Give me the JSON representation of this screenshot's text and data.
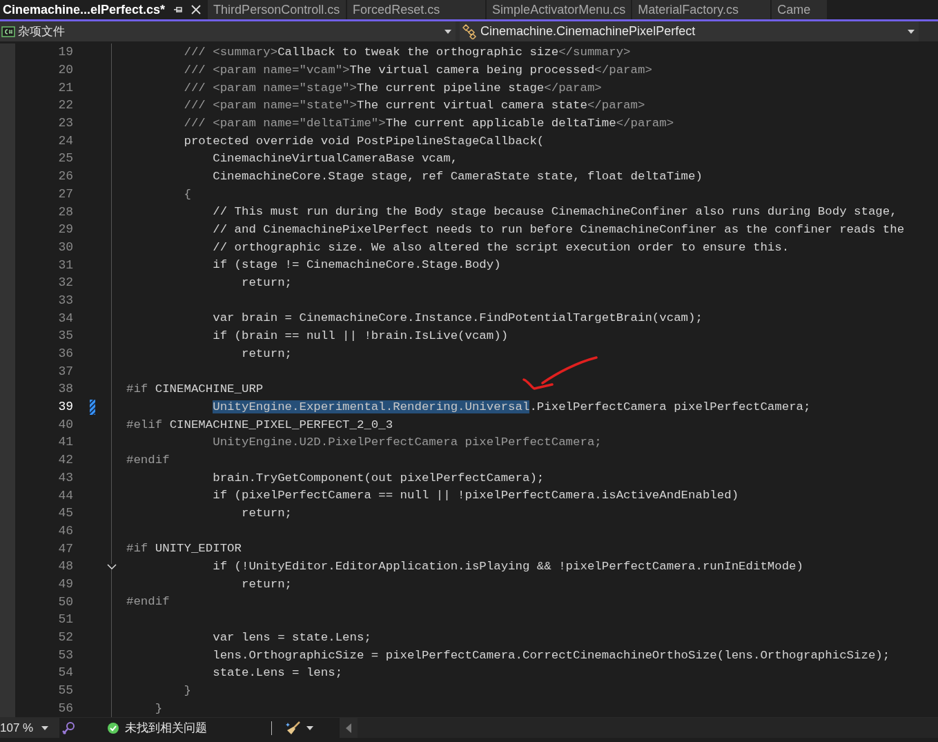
{
  "tabs": [
    {
      "label": "Cinemachine...elPerfect.cs*",
      "selected": true
    },
    {
      "label": "ThirdPersonControll.cs",
      "selected": false
    },
    {
      "label": "ForcedReset.cs",
      "selected": false
    },
    {
      "label": "SimpleActivatorMenu.cs",
      "selected": false
    },
    {
      "label": "MaterialFactory.cs",
      "selected": false
    },
    {
      "label": "Came",
      "selected": false
    }
  ],
  "nav_bar": {
    "project": "杂项文件",
    "class": "Cinemachine.CinemachinePixelPerfect"
  },
  "editor": {
    "lines": [
      {
        "number": "19",
        "current": false,
        "changed": false,
        "fold": false,
        "segments": [
          {
            "text": "        /// <summary>",
            "kind": "muted"
          },
          {
            "text": "Callback to tweak the orthographic size",
            "kind": "plain"
          },
          {
            "text": "</summary>",
            "kind": "muted"
          }
        ]
      },
      {
        "number": "20",
        "current": false,
        "changed": false,
        "fold": false,
        "segments": [
          {
            "text": "        /// <param name=\"vcam\">",
            "kind": "muted"
          },
          {
            "text": "The virtual camera being processed",
            "kind": "plain"
          },
          {
            "text": "</param>",
            "kind": "muted"
          }
        ]
      },
      {
        "number": "21",
        "current": false,
        "changed": false,
        "fold": false,
        "segments": [
          {
            "text": "        /// <param name=\"stage\">",
            "kind": "muted"
          },
          {
            "text": "The current pipeline stage",
            "kind": "plain"
          },
          {
            "text": "</param>",
            "kind": "muted"
          }
        ]
      },
      {
        "number": "22",
        "current": false,
        "changed": false,
        "fold": false,
        "segments": [
          {
            "text": "        /// <param name=\"state\">",
            "kind": "muted"
          },
          {
            "text": "The current virtual camera state",
            "kind": "plain"
          },
          {
            "text": "</param>",
            "kind": "muted"
          }
        ]
      },
      {
        "number": "23",
        "current": false,
        "changed": false,
        "fold": false,
        "segments": [
          {
            "text": "        /// <param name=\"deltaTime\">",
            "kind": "muted"
          },
          {
            "text": "The current applicable deltaTime",
            "kind": "plain"
          },
          {
            "text": "</param>",
            "kind": "muted"
          }
        ]
      },
      {
        "number": "24",
        "current": false,
        "changed": false,
        "fold": false,
        "segments": [
          {
            "text": "        protected override void PostPipelineStageCallback(",
            "kind": "plain"
          }
        ]
      },
      {
        "number": "25",
        "current": false,
        "changed": false,
        "fold": false,
        "segments": [
          {
            "text": "            CinemachineVirtualCameraBase vcam,",
            "kind": "plain"
          }
        ]
      },
      {
        "number": "26",
        "current": false,
        "changed": false,
        "fold": false,
        "segments": [
          {
            "text": "            CinemachineCore.Stage stage, ref CameraState state, float deltaTime)",
            "kind": "plain"
          }
        ]
      },
      {
        "number": "27",
        "current": false,
        "changed": false,
        "fold": false,
        "segments": [
          {
            "text": "        {",
            "kind": "muted"
          }
        ]
      },
      {
        "number": "28",
        "current": false,
        "changed": false,
        "fold": false,
        "segments": [
          {
            "text": "            // This must run during the Body stage because CinemachineConfiner also runs during Body stage,",
            "kind": "plain"
          }
        ]
      },
      {
        "number": "29",
        "current": false,
        "changed": false,
        "fold": false,
        "segments": [
          {
            "text": "            // and CinemachinePixelPerfect needs to run before CinemachineConfiner as the confiner reads the",
            "kind": "plain"
          }
        ]
      },
      {
        "number": "30",
        "current": false,
        "changed": false,
        "fold": false,
        "segments": [
          {
            "text": "            // orthographic size. We also altered the script execution order to ensure this.",
            "kind": "plain"
          }
        ]
      },
      {
        "number": "31",
        "current": false,
        "changed": false,
        "fold": false,
        "segments": [
          {
            "text": "            if (stage != CinemachineCore.Stage.Body)",
            "kind": "plain"
          }
        ]
      },
      {
        "number": "32",
        "current": false,
        "changed": false,
        "fold": false,
        "segments": [
          {
            "text": "                return;",
            "kind": "plain"
          }
        ]
      },
      {
        "number": "33",
        "current": false,
        "changed": false,
        "fold": false
      },
      {
        "number": "34",
        "current": false,
        "changed": false,
        "fold": false,
        "segments": [
          {
            "text": "            var brain = CinemachineCore.Instance.FindPotentialTargetBrain(vcam);",
            "kind": "plain"
          }
        ]
      },
      {
        "number": "35",
        "current": false,
        "changed": false,
        "fold": false,
        "segments": [
          {
            "text": "            if (brain == null || !brain.IsLive(vcam))",
            "kind": "plain"
          }
        ]
      },
      {
        "number": "36",
        "current": false,
        "changed": false,
        "fold": false,
        "segments": [
          {
            "text": "                return;",
            "kind": "plain"
          }
        ]
      },
      {
        "number": "37",
        "current": false,
        "changed": false,
        "fold": false
      },
      {
        "number": "38",
        "current": false,
        "changed": false,
        "fold": false,
        "segments": [
          {
            "text": "#if",
            "kind": "muted"
          },
          {
            "text": " CINEMACHINE_URP",
            "kind": "plain"
          }
        ]
      },
      {
        "number": "39",
        "current": true,
        "changed": true,
        "fold": false,
        "segments": [
          {
            "text": "            UnityEngine.Experimental.Rendering.Universal",
            "kind": "selected"
          },
          {
            "text": ".PixelPerfectCamera pixelPerfectCamera;",
            "kind": "plain"
          }
        ]
      },
      {
        "number": "40",
        "current": false,
        "changed": false,
        "fold": false,
        "segments": [
          {
            "text": "#elif",
            "kind": "muted"
          },
          {
            "text": " CINEMACHINE_PIXEL_PERFECT_2_0_3",
            "kind": "plain"
          }
        ]
      },
      {
        "number": "41",
        "current": false,
        "changed": false,
        "fold": false,
        "segments": [
          {
            "text": "            UnityEngine.U2D.PixelPerfectCamera pixelPerfectCamera;",
            "kind": "muted"
          }
        ]
      },
      {
        "number": "42",
        "current": false,
        "changed": false,
        "fold": false,
        "segments": [
          {
            "text": "#endif",
            "kind": "muted"
          }
        ]
      },
      {
        "number": "43",
        "current": false,
        "changed": false,
        "fold": false,
        "segments": [
          {
            "text": "            brain.TryGetComponent(out pixelPerfectCamera);",
            "kind": "plain"
          }
        ]
      },
      {
        "number": "44",
        "current": false,
        "changed": false,
        "fold": false,
        "segments": [
          {
            "text": "            if (pixelPerfectCamera == null || !pixelPerfectCamera.isActiveAndEnabled)",
            "kind": "plain"
          }
        ]
      },
      {
        "number": "45",
        "current": false,
        "changed": false,
        "fold": false,
        "segments": [
          {
            "text": "                return;",
            "kind": "plain"
          }
        ]
      },
      {
        "number": "46",
        "current": false,
        "changed": false,
        "fold": false
      },
      {
        "number": "47",
        "current": false,
        "changed": false,
        "fold": false,
        "segments": [
          {
            "text": "#if",
            "kind": "muted"
          },
          {
            "text": " UNITY_EDITOR",
            "kind": "plain"
          }
        ]
      },
      {
        "number": "48",
        "current": false,
        "changed": false,
        "fold": true,
        "segments": [
          {
            "text": "            if (!UnityEditor.EditorApplication.isPlaying && !pixelPerfectCamera.runInEditMode)",
            "kind": "plain"
          }
        ]
      },
      {
        "number": "49",
        "current": false,
        "changed": false,
        "fold": false,
        "segments": [
          {
            "text": "                return;",
            "kind": "plain"
          }
        ]
      },
      {
        "number": "50",
        "current": false,
        "changed": false,
        "fold": false,
        "segments": [
          {
            "text": "#endif",
            "kind": "muted"
          }
        ]
      },
      {
        "number": "51",
        "current": false,
        "changed": false,
        "fold": false
      },
      {
        "number": "52",
        "current": false,
        "changed": false,
        "fold": false,
        "segments": [
          {
            "text": "            var lens = state.Lens;",
            "kind": "plain"
          }
        ]
      },
      {
        "number": "53",
        "current": false,
        "changed": false,
        "fold": false,
        "segments": [
          {
            "text": "            lens.OrthographicSize = pixelPerfectCamera.CorrectCinemachineOrthoSize(lens.OrthographicSize);",
            "kind": "plain"
          }
        ]
      },
      {
        "number": "54",
        "current": false,
        "changed": false,
        "fold": false,
        "segments": [
          {
            "text": "            state.Lens = lens;",
            "kind": "plain"
          }
        ]
      },
      {
        "number": "55",
        "current": false,
        "changed": false,
        "fold": false,
        "segments": [
          {
            "text": "        }",
            "kind": "muted"
          }
        ]
      },
      {
        "number": "56",
        "current": false,
        "changed": false,
        "fold": false,
        "segments": [
          {
            "text": "    }",
            "kind": "muted"
          }
        ]
      }
    ]
  },
  "status_bar": {
    "zoom": "107 %",
    "issues": "未找到相关问题"
  }
}
